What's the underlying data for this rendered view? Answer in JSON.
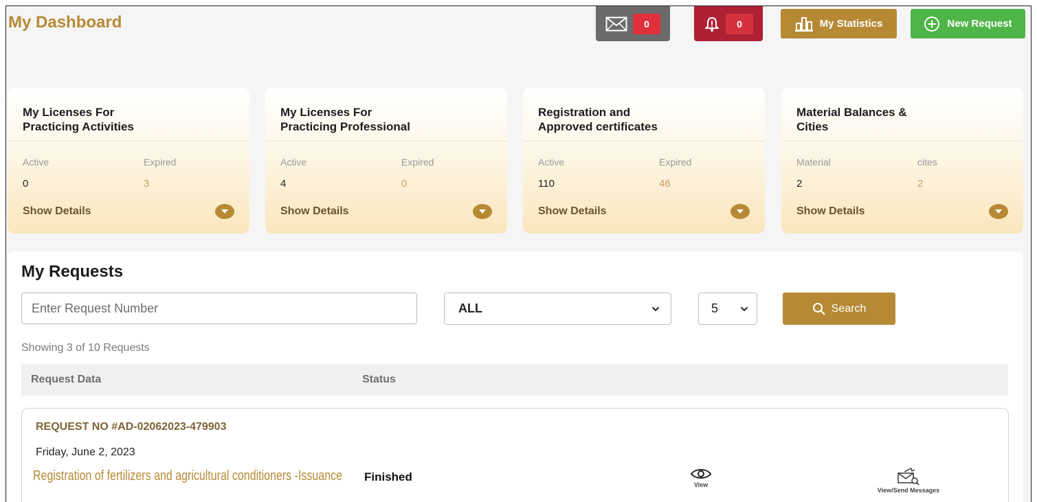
{
  "header": {
    "title": "My Dashboard",
    "messages_count": "0",
    "notifications_count": "0",
    "statistics_label": "My Statistics",
    "new_request_label": "New Request"
  },
  "cards": [
    {
      "title_line1": "My Licenses For",
      "title_line2": "Practicing Activities",
      "label1": "Active",
      "value1": "0",
      "label2": "Expired",
      "value2": "3",
      "show_details": "Show Details"
    },
    {
      "title_line1": "My Licenses For",
      "title_line2": "Practicing Professional",
      "label1": "Active",
      "value1": "4",
      "label2": "Expired",
      "value2": "0",
      "show_details": "Show Details"
    },
    {
      "title_line1": "Registration and",
      "title_line2": "Approved certificates",
      "label1": "Active",
      "value1": "110",
      "label2": "Expired",
      "value2": "46",
      "show_details": "Show Details"
    },
    {
      "title_line1": "Material Balances &",
      "title_line2": "Cities",
      "label1": "Material",
      "value1": "2",
      "label2": "cites",
      "value2": "2",
      "show_details": "Show Details"
    }
  ],
  "requests": {
    "title": "My Requests",
    "search_placeholder": "Enter Request Number",
    "status_filter": "ALL",
    "page_size": "5",
    "search_label": "Search",
    "showing_text": "Showing 3 of 10 Requests",
    "columns": [
      "Request Data",
      "Status"
    ],
    "items": [
      {
        "number": "REQUEST NO #AD-02062023-479903",
        "date": "Friday, June 2, 2023",
        "service": "Registration of fertilizers and agricultural conditioners -Issuance",
        "status": "Finished",
        "view_label": "View",
        "messages_label": "View/Send Messages"
      }
    ]
  },
  "colors": {
    "brand_gold": "#b68a35",
    "success_green": "#4fb548",
    "alert_red": "#b02035",
    "neutral_gray": "#6b6b6b"
  },
  "icons": [
    "mail-icon",
    "bell-icon",
    "bar-chart-icon",
    "plus-circle-icon",
    "chevron-down-icon",
    "search-icon",
    "eye-icon",
    "envelope-search-icon"
  ]
}
